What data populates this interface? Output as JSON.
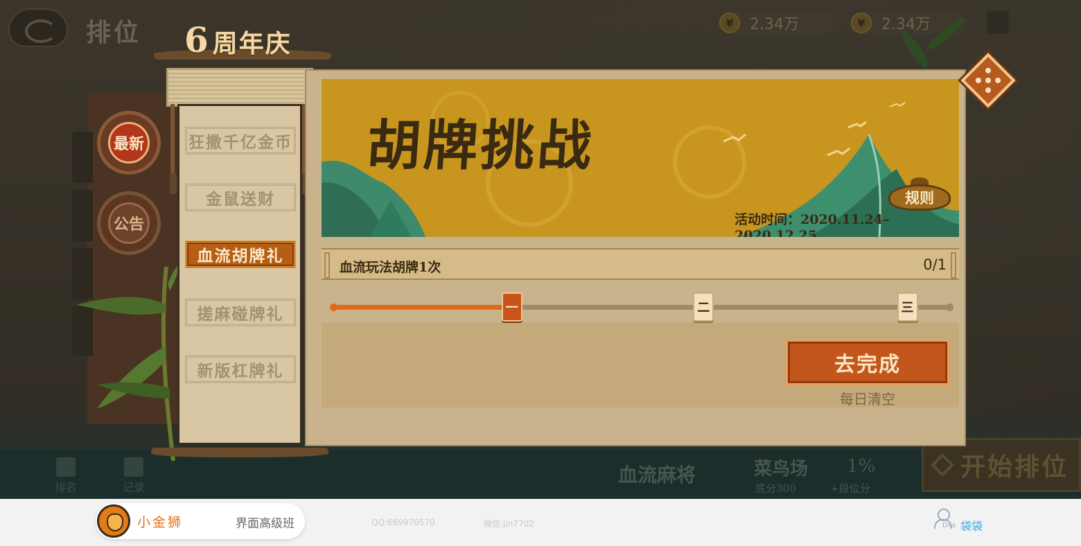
{
  "background": {
    "title": "排位",
    "coins": [
      {
        "icon": "¥",
        "value": "2.34万"
      },
      {
        "icon": "¥",
        "value": "2.34万"
      }
    ],
    "bottom_nav": [
      {
        "label": "排名"
      },
      {
        "label": "记录"
      }
    ],
    "mode": "血流麻将",
    "room": {
      "name": "菜鸟场",
      "sub": "底分300"
    },
    "rank": {
      "pct": "1%",
      "sub": "+段位分"
    },
    "start_label": "开始排位",
    "side_badges": [
      "最新",
      "公告"
    ]
  },
  "popup": {
    "anniversary": {
      "number": "6",
      "text": "周年庆"
    },
    "tabs": [
      {
        "label": "狂撒千亿金币",
        "active": false
      },
      {
        "label": "金鼠送财",
        "active": false
      },
      {
        "label": "血流胡牌礼",
        "active": true
      },
      {
        "label": "搓麻碰牌礼",
        "active": false
      },
      {
        "label": "新版杠牌礼",
        "active": false
      }
    ],
    "banner": {
      "title": "胡牌挑战",
      "rule_label": "规则",
      "activity_time": "活动时间：2020.11.24–2020.12.25"
    },
    "task": {
      "name": "血流玩法胡牌1次",
      "progress": "0/1",
      "progress_fraction": 0.29,
      "milestones": [
        {
          "label": "一",
          "position": 0.29,
          "done": true
        },
        {
          "label": "二",
          "position": 0.6,
          "done": false
        },
        {
          "label": "三",
          "position": 0.93,
          "done": false
        }
      ],
      "action_label": "去完成",
      "reset_note": "每日清空"
    }
  },
  "watermark": {
    "brand": "小金狮",
    "course": "界面高级班",
    "qq": "QQ:669970570",
    "wechat": "微信:jin7702",
    "des": "Des",
    "user": "袋袋"
  },
  "colors": {
    "accent_orange": "#c3561d",
    "progress_fill": "#e06a1b",
    "banner_gold": "#c08f1e",
    "panel_tan": "#c9b38d"
  }
}
